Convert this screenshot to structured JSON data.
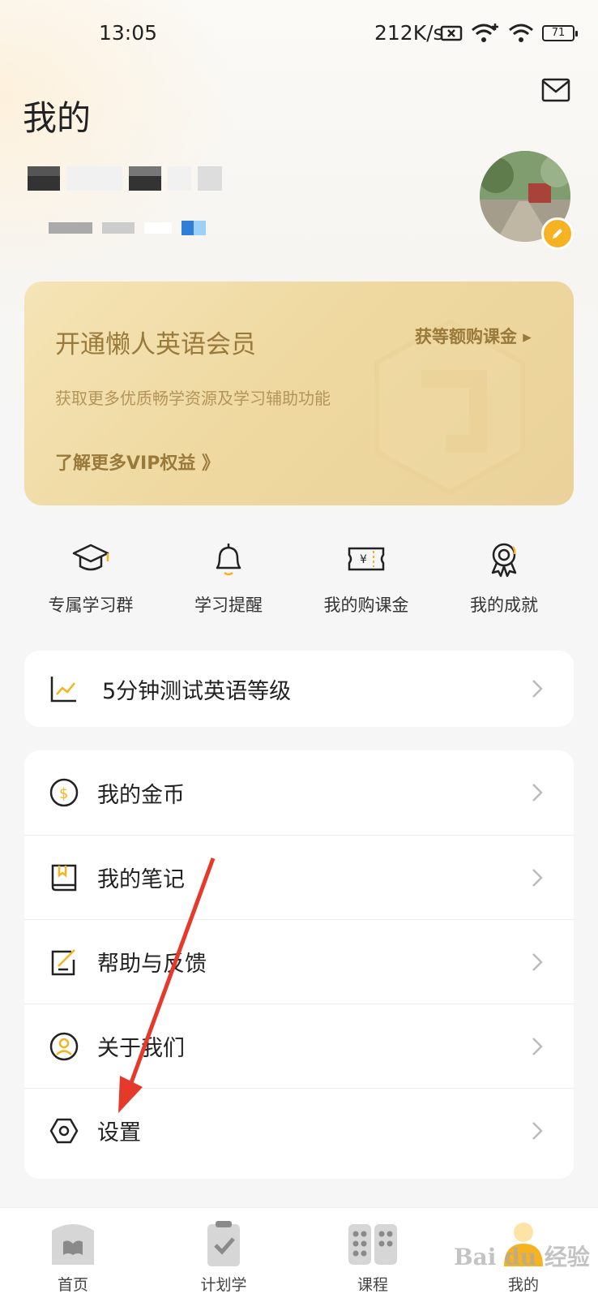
{
  "status": {
    "time": "13:05",
    "speed": "212K/s",
    "battery": "71"
  },
  "header": {
    "title": "我的"
  },
  "vip": {
    "title": "开通懒人英语会员",
    "subtitle": "获取更多优质畅学资源及学习辅助功能",
    "link": "了解更多VIP权益 》",
    "right_link": "获等额购课金 ▸"
  },
  "quick": [
    {
      "label": "专属学习群",
      "icon": "graduation-cap-icon"
    },
    {
      "label": "学习提醒",
      "icon": "bell-icon"
    },
    {
      "label": "我的购课金",
      "icon": "ticket-icon"
    },
    {
      "label": "我的成就",
      "icon": "award-icon"
    }
  ],
  "test": {
    "label": "5分钟测试英语等级",
    "icon": "chart-icon"
  },
  "menu": [
    {
      "label": "我的金币",
      "icon": "coin-icon"
    },
    {
      "label": "我的笔记",
      "icon": "notebook-icon"
    },
    {
      "label": "帮助与反馈",
      "icon": "feedback-icon"
    },
    {
      "label": "关于我们",
      "icon": "user-circle-icon"
    },
    {
      "label": "设置",
      "icon": "settings-icon"
    }
  ],
  "tabs": [
    {
      "label": "首页",
      "icon": "home-icon"
    },
    {
      "label": "计划学",
      "icon": "clipboard-check-icon"
    },
    {
      "label": "课程",
      "icon": "grid-icon"
    },
    {
      "label": "我的",
      "icon": "profile-icon",
      "active": true
    }
  ],
  "watermark": "Bai du 经验",
  "colors": {
    "accent": "#f6b321",
    "vip_text": "#9a7a3b",
    "arrow": "#e53a2b"
  }
}
